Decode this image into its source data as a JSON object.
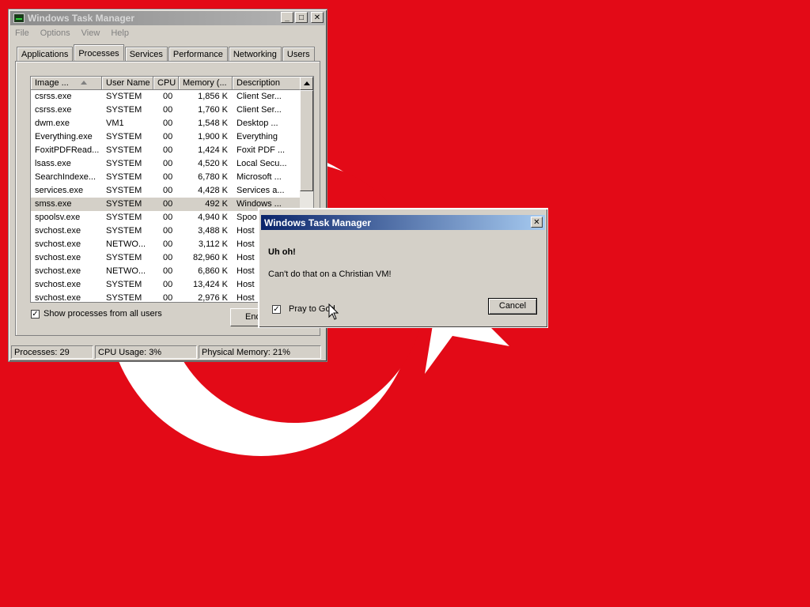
{
  "task_manager": {
    "title": "Windows Task Manager",
    "menu": [
      "File",
      "Options",
      "View",
      "Help"
    ],
    "tabs": [
      "Applications",
      "Processes",
      "Services",
      "Performance",
      "Networking",
      "Users"
    ],
    "selected_tab": "Processes",
    "columns": [
      "Image ...",
      "User Name",
      "CPU",
      "Memory (...",
      "Description"
    ],
    "processes": [
      {
        "image": "csrss.exe",
        "user": "SYSTEM",
        "cpu": "00",
        "memory": "1,856 K",
        "description": "Client Ser..."
      },
      {
        "image": "csrss.exe",
        "user": "SYSTEM",
        "cpu": "00",
        "memory": "1,760 K",
        "description": "Client Ser..."
      },
      {
        "image": "dwm.exe",
        "user": "VM1",
        "cpu": "00",
        "memory": "1,548 K",
        "description": "Desktop ..."
      },
      {
        "image": "Everything.exe",
        "user": "SYSTEM",
        "cpu": "00",
        "memory": "1,900 K",
        "description": "Everything"
      },
      {
        "image": "FoxitPDFRead...",
        "user": "SYSTEM",
        "cpu": "00",
        "memory": "1,424 K",
        "description": "Foxit PDF ..."
      },
      {
        "image": "lsass.exe",
        "user": "SYSTEM",
        "cpu": "00",
        "memory": "4,520 K",
        "description": "Local Secu..."
      },
      {
        "image": "SearchIndexe...",
        "user": "SYSTEM",
        "cpu": "00",
        "memory": "6,780 K",
        "description": "Microsoft ..."
      },
      {
        "image": "services.exe",
        "user": "SYSTEM",
        "cpu": "00",
        "memory": "4,428 K",
        "description": "Services a..."
      },
      {
        "image": "smss.exe",
        "user": "SYSTEM",
        "cpu": "00",
        "memory": "492 K",
        "description": "Windows ..."
      },
      {
        "image": "spoolsv.exe",
        "user": "SYSTEM",
        "cpu": "00",
        "memory": "4,940 K",
        "description": "Spoo"
      },
      {
        "image": "svchost.exe",
        "user": "SYSTEM",
        "cpu": "00",
        "memory": "3,488 K",
        "description": "Host"
      },
      {
        "image": "svchost.exe",
        "user": "NETWO...",
        "cpu": "00",
        "memory": "3,112 K",
        "description": "Host"
      },
      {
        "image": "svchost.exe",
        "user": "SYSTEM",
        "cpu": "00",
        "memory": "82,960 K",
        "description": "Host"
      },
      {
        "image": "svchost.exe",
        "user": "NETWO...",
        "cpu": "00",
        "memory": "6,860 K",
        "description": "Host"
      },
      {
        "image": "svchost.exe",
        "user": "SYSTEM",
        "cpu": "00",
        "memory": "13,424 K",
        "description": "Host"
      },
      {
        "image": "svchost.exe",
        "user": "SYSTEM",
        "cpu": "00",
        "memory": "2,976 K",
        "description": "Host"
      }
    ],
    "selected_process": "smss.exe",
    "show_all_users_label": "Show processes from all users",
    "show_all_users_checked": true,
    "end_button_label": "End",
    "status": {
      "processes": "Processes: 29",
      "cpu": "CPU Usage: 3%",
      "memory": "Physical Memory: 21%"
    }
  },
  "dialog": {
    "title": "Windows Task Manager",
    "heading": "Uh oh!",
    "message": "Can't do that on a Christian VM!",
    "checkbox_label": "Pray to God",
    "checkbox_checked": true,
    "cancel_label": "Cancel",
    "check_mark": "✓",
    "close_glyph": "✕"
  },
  "titlebar_glyphs": {
    "minimize": "_",
    "maximize": "□",
    "close": "✕"
  },
  "colors": {
    "wallpaper": "#e30a17",
    "flag_white": "#ffffff"
  }
}
